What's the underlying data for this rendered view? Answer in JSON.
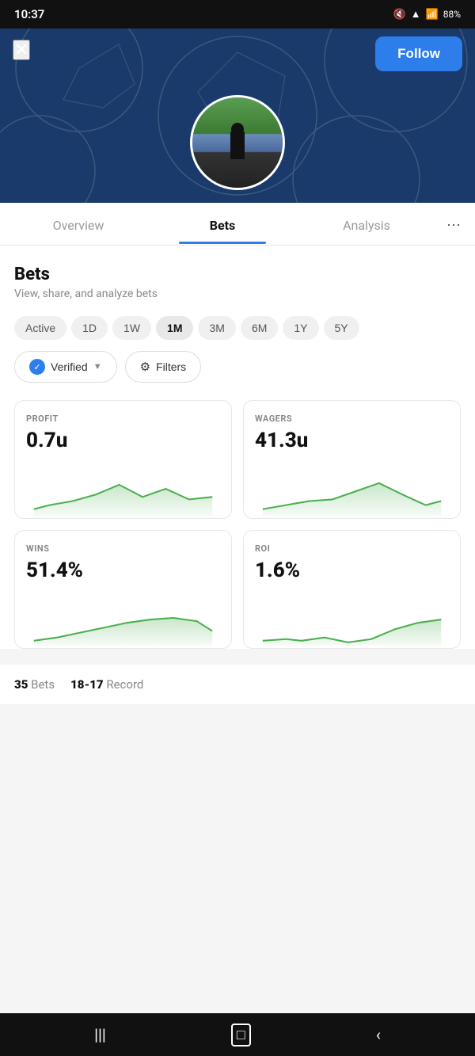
{
  "statusBar": {
    "time": "10:37",
    "battery": "88%"
  },
  "header": {
    "closeLabel": "✕",
    "followLabel": "Follow"
  },
  "tabs": [
    {
      "id": "overview",
      "label": "Overview",
      "active": false
    },
    {
      "id": "bets",
      "label": "Bets",
      "active": true
    },
    {
      "id": "analysis",
      "label": "Analysis",
      "active": false
    }
  ],
  "section": {
    "title": "Bets",
    "subtitle": "View, share, and analyze bets"
  },
  "timeFilters": [
    {
      "id": "active",
      "label": "Active",
      "active": false
    },
    {
      "id": "1d",
      "label": "1D",
      "active": false
    },
    {
      "id": "1w",
      "label": "1W",
      "active": false
    },
    {
      "id": "1m",
      "label": "1M",
      "active": true
    },
    {
      "id": "3m",
      "label": "3M",
      "active": false
    },
    {
      "id": "6m",
      "label": "6M",
      "active": false
    },
    {
      "id": "1y",
      "label": "1Y",
      "active": false
    },
    {
      "id": "5y",
      "label": "5Y",
      "active": false
    }
  ],
  "filterButtons": {
    "verified": "Verified",
    "filters": "Filters"
  },
  "stats": [
    {
      "id": "profit",
      "label": "PROFIT",
      "value": "0.7u",
      "chartPoints": "10,60 30,55 60,50 90,42 120,30 150,45 180,35 210,48 240,45",
      "fillPoints": "10,60 30,55 60,50 90,42 120,30 150,45 180,35 210,48 240,45 240,68 10,68"
    },
    {
      "id": "wagers",
      "label": "WAGERS",
      "value": "41.3u",
      "chartPoints": "10,60 40,55 70,50 100,48 130,38 160,28 190,42 220,55 240,50",
      "fillPoints": "10,60 40,55 70,50 100,48 130,38 160,28 190,42 220,55 240,50 240,68 10,68"
    },
    {
      "id": "wins",
      "label": "WINS",
      "value": "51.4%",
      "chartPoints": "10,62 40,58 70,52 100,46 130,40 160,36 190,34 220,38 240,50",
      "fillPoints": "10,62 40,58 70,52 100,46 130,40 160,36 190,34 220,38 240,50 240,68 10,68"
    },
    {
      "id": "roi",
      "label": "ROI",
      "value": "1.6%",
      "chartPoints": "10,62 40,60 60,62 90,58 120,64 150,60 180,48 210,40 240,36",
      "fillPoints": "10,62 40,60 60,62 90,58 120,64 150,60 180,48 210,40 240,36 240,68 10,68"
    }
  ],
  "summary": {
    "bets": "35",
    "betsLabel": "Bets",
    "record": "18-17",
    "recordLabel": "Record"
  }
}
